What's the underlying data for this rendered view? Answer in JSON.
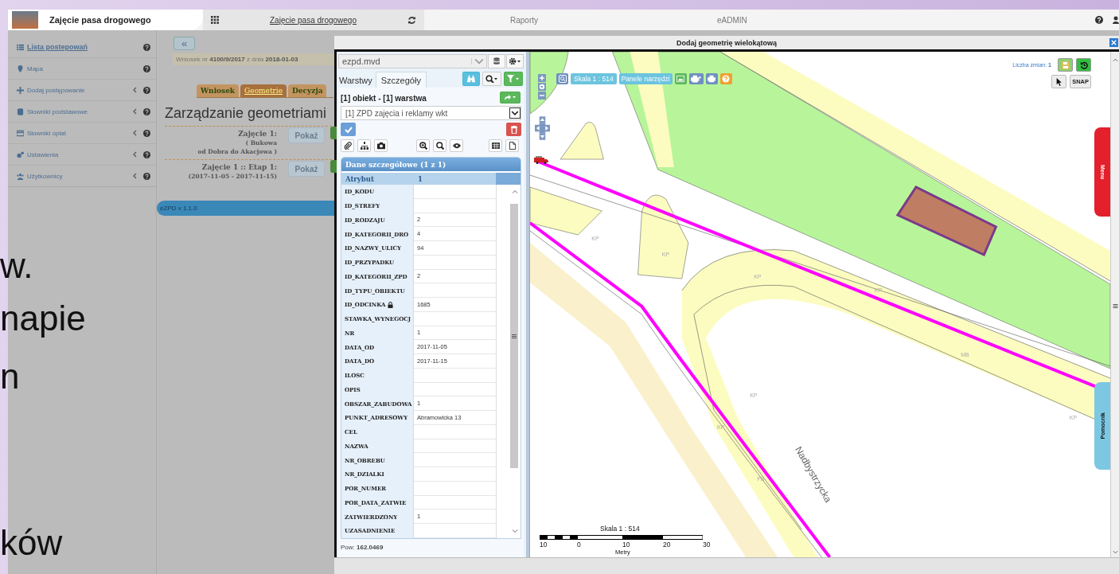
{
  "slide_text": [
    "w.",
    "napie",
    "n",
    "ków"
  ],
  "header": {
    "app_title": "Zajęcie pasa drogowego",
    "nav": [
      {
        "label": "Zajęcie pasa drogowego",
        "selected": true
      },
      {
        "label": "Raporty",
        "selected": false
      },
      {
        "label": "eADMIN",
        "selected": false
      }
    ]
  },
  "sidebar": {
    "items": [
      {
        "label": "Lista postepowań",
        "selected": true,
        "expandable": false
      },
      {
        "label": "Mapa",
        "selected": false,
        "expandable": false
      },
      {
        "label": "Dodaj postępowanie",
        "selected": false,
        "expandable": true
      },
      {
        "label": "Słowniki podstawowe",
        "selected": false,
        "expandable": true
      },
      {
        "label": "Słowniki opłat",
        "selected": false,
        "expandable": true
      },
      {
        "label": "Ustawienia",
        "selected": false,
        "expandable": true
      },
      {
        "label": "Użytkownicy",
        "selected": false,
        "expandable": true
      }
    ]
  },
  "main": {
    "collapse_button": "«",
    "request": "Wniosek nr **4100/9/2017** z dnia **2018-01-03**",
    "tabs": [
      {
        "label": "Wniosek",
        "selected": false
      },
      {
        "label": "Geometrie",
        "selected": true
      },
      {
        "label": "Decyzja",
        "selected": false
      }
    ],
    "heading": "Zarządzanie geometriami",
    "occupations": [
      {
        "title": "Zajęcie 1:",
        "detail": [
          "( Bukowa",
          "od Dobra do Akacjowa )"
        ],
        "button": "Pokaż"
      },
      {
        "title": "Zajęcie 1 :: Etap 1:",
        "detail": [
          "(2017-11-05 - 2017-11-15)"
        ],
        "button": "Pokaż"
      }
    ],
    "version": "eZPD v 1.1.0"
  },
  "dialog": {
    "title": "Dodaj geometrię wielokątową",
    "panel": {
      "source_select": "ezpd.mvd",
      "tabs": [
        {
          "label": "Warstwy",
          "selected": false
        },
        {
          "label": "Szczegóły",
          "selected": true
        }
      ],
      "object_heading": "[1] obiekt - [1] warstwa",
      "layer_select": "[1] ZPD zajęcia i reklamy wkt",
      "details_title": "Dane szczegółowe (1 z 1)",
      "columns": [
        "Atrybut",
        "1"
      ],
      "rows": [
        {
          "name": "ID_KODU",
          "locked": false
        },
        {
          "name": "ID_STREFY",
          "locked": false
        },
        {
          "name": "ID_RODZAJU",
          "value": "2",
          "locked": false
        },
        {
          "name": "ID_KATEGORII_DRO",
          "value": "4",
          "locked": false
        },
        {
          "name": "ID_NAZWY_ULICY",
          "value": "94",
          "locked": false
        },
        {
          "name": "ID_PRZYPADKU",
          "locked": false
        },
        {
          "name": "ID_KATEGORII_ZPD",
          "value": "2",
          "locked": false
        },
        {
          "name": "ID_TYPU_OBIEKTU",
          "locked": false
        },
        {
          "name": "ID_ODCINKA",
          "value": "1685",
          "locked": true
        },
        {
          "name": "STAWKA_WYNEGOCJ",
          "locked": false
        },
        {
          "name": "NR",
          "value": "1",
          "locked": false
        },
        {
          "name": "DATA_OD",
          "value": "2017-11-05",
          "locked": false
        },
        {
          "name": "DATA_DO",
          "value": "2017-11-15",
          "locked": false
        },
        {
          "name": "ILOSC",
          "locked": false
        },
        {
          "name": "OPIS",
          "locked": false
        },
        {
          "name": "OBSZAR_ZABUDOWA",
          "value": "1",
          "locked": false
        },
        {
          "name": "PUNKT_ADRESOWY",
          "value": "Abramowicka 13",
          "locked": false
        },
        {
          "name": "CEL",
          "locked": false
        },
        {
          "name": "NAZWA",
          "locked": false
        },
        {
          "name": "NR_OBREBU",
          "locked": false
        },
        {
          "name": "NR_DZIALKI",
          "locked": false
        },
        {
          "name": "POR_NUMER",
          "locked": false
        },
        {
          "name": "POR_DATA_ZATWIE",
          "locked": false
        },
        {
          "name": "ZATWIERDZONY",
          "value": "1",
          "locked": false
        },
        {
          "name": "UZASADNIENIE",
          "locked": false
        }
      ],
      "area": "Pow: **162.0469**"
    },
    "map": {
      "scale_badge": "Skala 1 : 514",
      "tools_button": "Panele narzędzi",
      "changes": "Liczba zmian: **1**",
      "snap_label": "SNAP",
      "side_tabs": [
        {
          "label": "Menu",
          "color": "#e3202c"
        },
        {
          "label": "Pomocnik",
          "color": "#7cc8e2"
        }
      ],
      "labels": [
        "KP",
        "KP",
        "KP",
        "KP",
        "MB",
        "KP",
        "KP",
        "KP",
        "PB"
      ],
      "street_name": "Nadbystrzycka",
      "scale_bar": {
        "title": "Skala 1 : 514",
        "ticks": [
          "10",
          "0",
          "10",
          "20",
          "30"
        ],
        "unit": "Metry"
      }
    }
  }
}
